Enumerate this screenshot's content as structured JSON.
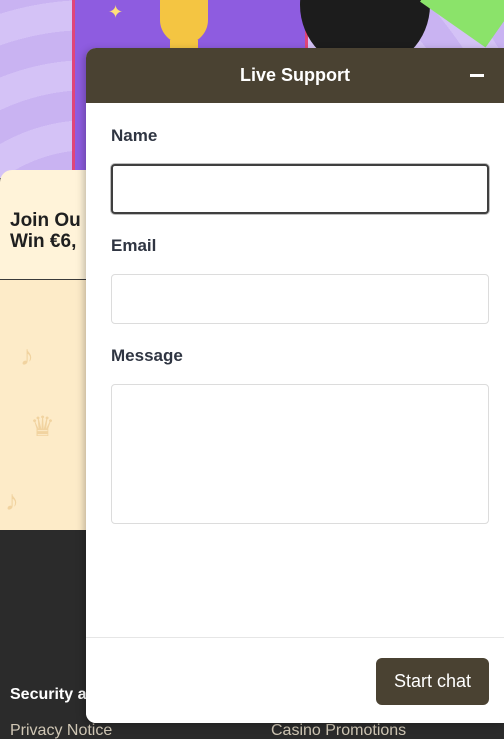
{
  "background": {
    "promo_text_line1": "Join Ou",
    "promo_text_line2": "Win €6,",
    "footer_heading": "Security a",
    "footer_link_left": "Privacy Notice",
    "footer_link_right": "Casino Promotions"
  },
  "chat": {
    "title": "Live Support",
    "minimize_icon": "minus-icon",
    "fields": {
      "name_label": "Name",
      "name_value": "",
      "email_label": "Email",
      "email_value": "",
      "message_label": "Message",
      "message_value": ""
    },
    "start_button_label": "Start chat"
  },
  "colors": {
    "header_bg": "#4a4232",
    "button_bg": "#4a4232",
    "label_text": "#2f3542"
  }
}
